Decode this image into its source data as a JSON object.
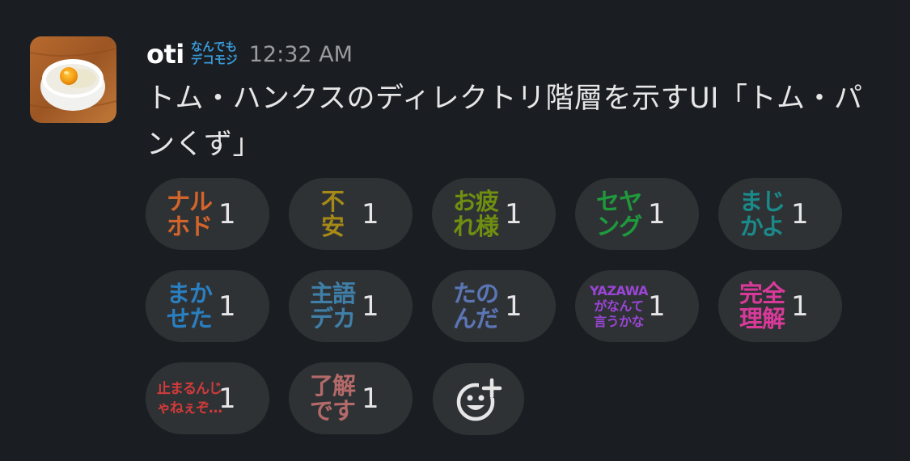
{
  "message": {
    "username": "oti",
    "status_emoji_lines": [
      "なんでも",
      "デコモジ"
    ],
    "timestamp": "12:32 AM",
    "text": "トム・ハンクスのディレクトリ階層を示すUI「トム・パンくず」"
  },
  "reactions": [
    {
      "lines": [
        "ナル",
        "ホド"
      ],
      "color": "#d4652a",
      "count": "1"
    },
    {
      "lines": [
        "不",
        "安"
      ],
      "color": "#a78a16",
      "count": "1"
    },
    {
      "lines": [
        "お疲",
        "れ様"
      ],
      "color": "#6f8f10",
      "count": "1"
    },
    {
      "lines": [
        "セヤ",
        "ング"
      ],
      "color": "#1e9a3c",
      "count": "1"
    },
    {
      "lines": [
        "まじ",
        "かよ"
      ],
      "color": "#1a8a8a",
      "count": "1"
    },
    {
      "lines": [
        "まか",
        "せた"
      ],
      "color": "#2a7fc0",
      "count": "1"
    },
    {
      "lines": [
        "主語",
        "デカ"
      ],
      "color": "#3f7fa8",
      "count": "1"
    },
    {
      "lines": [
        "たの",
        "んだ"
      ],
      "color": "#5b76b5",
      "count": "1"
    },
    {
      "lines": [
        "YAZAWA",
        "がなんて",
        "言うかな"
      ],
      "color": "#9b45d6",
      "count": "1"
    },
    {
      "lines": [
        "完全",
        "理解"
      ],
      "color": "#d93a9a",
      "count": "1"
    },
    {
      "lines": [
        "止まるんじ",
        "ゃねぇぞ…"
      ],
      "color": "#d23a3a",
      "count": "1"
    },
    {
      "lines": [
        "了解",
        "です"
      ],
      "color": "#b56a6a",
      "count": "1"
    }
  ],
  "icons": {
    "add_reaction": "add-reaction-icon"
  }
}
